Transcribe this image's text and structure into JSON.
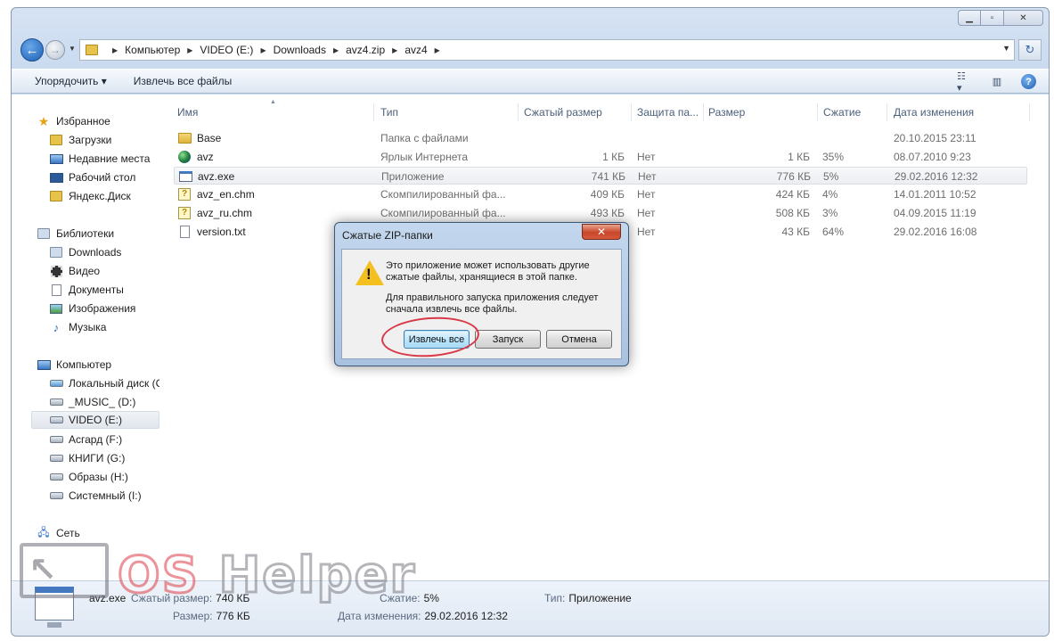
{
  "address": {
    "crumbs": [
      "Компьютер",
      "VIDEO (E:)",
      "Downloads",
      "avz4.zip",
      "avz4"
    ]
  },
  "toolbar": {
    "organize": "Упорядочить ▾",
    "extract_all": "Извлечь все файлы"
  },
  "sidebar": {
    "favorites": {
      "label": "Избранное",
      "items": [
        "Загрузки",
        "Недавние места",
        "Рабочий стол",
        "Яндекс.Диск"
      ]
    },
    "libraries": {
      "label": "Библиотеки",
      "items": [
        "Downloads",
        "Видео",
        "Документы",
        "Изображения",
        "Музыка"
      ]
    },
    "computer": {
      "label": "Компьютер",
      "items": [
        "Локальный диск (C",
        "_MUSIC_ (D:)",
        "VIDEO (E:)",
        "Асгард (F:)",
        "КНИГИ (G:)",
        "Образы (H:)",
        "Системный (I:)"
      ]
    },
    "network": {
      "label": "Сеть"
    }
  },
  "columns": [
    "Имя",
    "Тип",
    "Сжатый размер",
    "Защита па...",
    "Размер",
    "Сжатие",
    "Дата изменения"
  ],
  "files": [
    {
      "name": "Base",
      "type": "Папка с файлами",
      "packed": "",
      "protect": "",
      "size": "",
      "ratio": "",
      "date": "20.10.2015 23:11",
      "icon": "folder-icon"
    },
    {
      "name": "avz",
      "type": "Ярлык Интернета",
      "packed": "1 КБ",
      "protect": "Нет",
      "size": "1 КБ",
      "ratio": "35%",
      "date": "08.07.2010 9:23",
      "icon": "globe-icon"
    },
    {
      "name": "avz.exe",
      "type": "Приложение",
      "packed": "741 КБ",
      "protect": "Нет",
      "size": "776 КБ",
      "ratio": "5%",
      "date": "29.02.2016 12:32",
      "icon": "exe-icon"
    },
    {
      "name": "avz_en.chm",
      "type": "Скомпилированный фа...",
      "packed": "409 КБ",
      "protect": "Нет",
      "size": "424 КБ",
      "ratio": "4%",
      "date": "14.01.2011 10:52",
      "icon": "chm-icon"
    },
    {
      "name": "avz_ru.chm",
      "type": "Скомпилированный фа...",
      "packed": "493 КБ",
      "protect": "Нет",
      "size": "508 КБ",
      "ratio": "3%",
      "date": "04.09.2015 11:19",
      "icon": "chm-icon"
    },
    {
      "name": "version.txt",
      "type": "",
      "packed": "",
      "protect": "Нет",
      "size": "43 КБ",
      "ratio": "64%",
      "date": "29.02.2016 16:08",
      "icon": "txt-icon"
    }
  ],
  "dialog": {
    "title": "Сжатые ZIP-папки",
    "text1": "Это приложение может использовать другие",
    "text2": "сжатые файлы, хранящиеся в этой папке.",
    "text3": "Для правильного запуска приложения следует",
    "text4": "сначала извлечь все файлы.",
    "btn_extract": "Извлечь все",
    "btn_run": "Запуск",
    "btn_cancel": "Отмена"
  },
  "details": {
    "filename": "avz.exe",
    "packed_label": "Сжатый размер:",
    "packed_value": "740 КБ",
    "size_label": "Размер:",
    "size_value": "776 КБ",
    "ratio_label": "Сжатие:",
    "ratio_value": "5%",
    "date_label": "Дата изменения:",
    "date_value": "29.02.2016 12:32",
    "type_label": "Тип:",
    "type_value": "Приложение"
  },
  "watermark": {
    "os": "OS",
    "helper": "Helper"
  }
}
